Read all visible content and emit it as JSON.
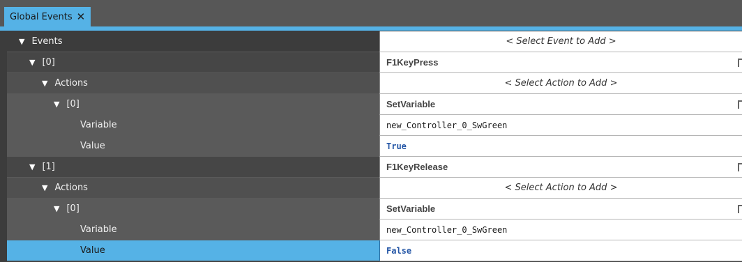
{
  "tab": {
    "title": "Global Events",
    "close_glyph": "✕"
  },
  "rows": [
    {
      "key": "events",
      "label": "Events",
      "value": "< Select Event to Add >"
    },
    {
      "key": "event0",
      "label": "[0]",
      "value": "F1KeyPress"
    },
    {
      "key": "actions0",
      "label": "Actions",
      "value": "< Select Action to Add >"
    },
    {
      "key": "action00",
      "label": "[0]",
      "value": "SetVariable"
    },
    {
      "key": "var00",
      "label": "Variable",
      "value": "new_Controller_0_SwGreen"
    },
    {
      "key": "val00",
      "label": "Value",
      "value": "True"
    },
    {
      "key": "event1",
      "label": "[1]",
      "value": "F1KeyRelease"
    },
    {
      "key": "actions1",
      "label": "Actions",
      "value": "< Select Action to Add >"
    },
    {
      "key": "action10",
      "label": "[0]",
      "value": "SetVariable"
    },
    {
      "key": "var10",
      "label": "Variable",
      "value": "new_Controller_0_SwGreen"
    },
    {
      "key": "val10",
      "label": "Value",
      "value": "False"
    }
  ],
  "icons": {
    "expand": "chevron-down-icon",
    "delete": "trash-icon"
  },
  "colors": {
    "accent": "#55b2e6",
    "bool_text": "#2456a6"
  }
}
